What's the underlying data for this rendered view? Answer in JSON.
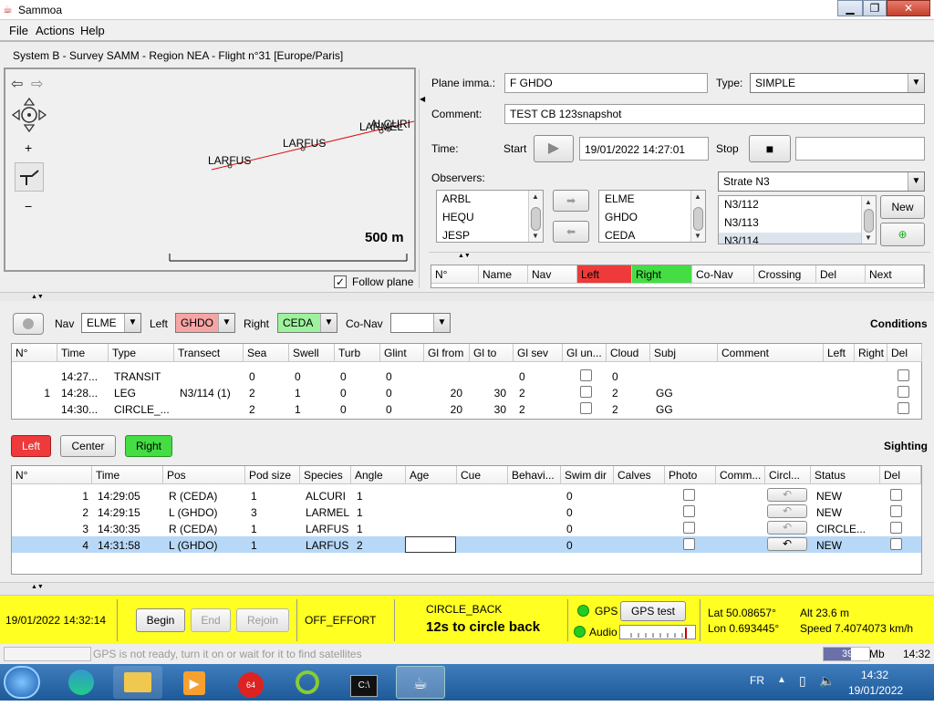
{
  "window": {
    "title": "Sammoa",
    "min": "▁",
    "max": "❐",
    "close": "✕"
  },
  "menu": {
    "file": "File",
    "actions": "Actions",
    "help": "Help"
  },
  "system_header": "System B - Survey SAMM - Region NEA - Flight n°31 [Europe/Paris]",
  "map": {
    "labels": [
      "LARFUS",
      "LARFUS",
      "LARMEL",
      "ALCURI"
    ],
    "scale": "500 m",
    "follow_plane": "Follow plane",
    "zoom_in": "+",
    "zoom_out": "−"
  },
  "flight": {
    "plane_label": "Plane imma.:",
    "plane_value": "F GHDO",
    "type_label": "Type:",
    "type_value": "SIMPLE",
    "comment_label": "Comment:",
    "comment_value": "TEST CB 123snapshot",
    "time_label": "Time:",
    "start_label": "Start",
    "start_value": "19/01/2022 14:27:01",
    "stop_label": "Stop",
    "stop_value": "",
    "observers_label": "Observers:",
    "observers_available": [
      "ARBL",
      "HEQU",
      "JESP"
    ],
    "observers_selected": [
      "ELME",
      "GHDO",
      "CEDA"
    ],
    "strate_value": "Strate N3",
    "transects": [
      "N3/112",
      "N3/113",
      "N3/114"
    ],
    "new_button": "New"
  },
  "leg_table": {
    "headers": [
      "N°",
      "Name",
      "Nav",
      "Left",
      "Right",
      "Co-Nav",
      "Crossing",
      "Del",
      "Next"
    ]
  },
  "crew": {
    "nav_label": "Nav",
    "nav_value": "ELME",
    "left_label": "Left",
    "left_value": "GHDO",
    "right_label": "Right",
    "right_value": "CEDA",
    "conav_label": "Co-Nav",
    "conav_value": "",
    "conditions_title": "Conditions"
  },
  "conditions": {
    "headers": [
      "N°",
      "Time",
      "Type",
      "Transect",
      "Sea",
      "Swell",
      "Turb",
      "Glint",
      "Gl from",
      "Gl to",
      "Gl sev",
      "Gl un...",
      "Cloud",
      "Subj",
      "Comment",
      "Left",
      "Right",
      "Del"
    ],
    "rows": [
      {
        "n": "",
        "time": "14:27...",
        "type": "TRANSIT",
        "transect": "",
        "sea": "0",
        "swell": "0",
        "turb": "0",
        "glint": "0",
        "glfrom": "",
        "glto": "",
        "glsev": "0",
        "cloud": "0",
        "subj": ""
      },
      {
        "n": "1",
        "time": "14:28...",
        "type": "LEG",
        "transect": "N3/114 (1)",
        "sea": "2",
        "swell": "1",
        "turb": "0",
        "glint": "0",
        "glfrom": "20",
        "glto": "30",
        "glsev": "2",
        "cloud": "2",
        "subj": "GG"
      },
      {
        "n": "",
        "time": "14:30...",
        "type": "CIRCLE_...",
        "transect": "",
        "sea": "2",
        "swell": "1",
        "turb": "0",
        "glint": "0",
        "glfrom": "20",
        "glto": "30",
        "glsev": "2",
        "cloud": "2",
        "subj": "GG"
      }
    ]
  },
  "sighting_buttons": {
    "left": "Left",
    "center": "Center",
    "right": "Right",
    "title": "Sighting"
  },
  "sightings": {
    "headers": [
      "N°",
      "Time",
      "Pos",
      "Pod size",
      "Species",
      "Angle",
      "Age",
      "Cue",
      "Behavi...",
      "Swim dir",
      "Calves",
      "Photo",
      "Comm...",
      "Circl...",
      "Status",
      "Del"
    ],
    "rows": [
      {
        "n": "1",
        "time": "14:29:05",
        "pos": "R (CEDA)",
        "pod": "1",
        "species": "ALCURI",
        "angle": "1",
        "swim": "0",
        "status": "NEW"
      },
      {
        "n": "2",
        "time": "14:29:15",
        "pos": "L (GHDO)",
        "pod": "3",
        "species": "LARMEL",
        "angle": "1",
        "swim": "0",
        "status": "NEW"
      },
      {
        "n": "3",
        "time": "14:30:35",
        "pos": "R (CEDA)",
        "pod": "1",
        "species": "LARFUS",
        "angle": "1",
        "swim": "0",
        "status": "CIRCLE..."
      },
      {
        "n": "4",
        "time": "14:31:58",
        "pos": "L (GHDO)",
        "pod": "1",
        "species": "LARFUS",
        "angle": "2",
        "swim": "0",
        "status": "NEW"
      }
    ]
  },
  "status": {
    "datetime": "19/01/2022 14:32:14",
    "begin": "Begin",
    "end": "End",
    "rejoin": "Rejoin",
    "effort": "OFF_EFFORT",
    "circle_title": "CIRCLE_BACK",
    "circle_msg": "12s to circle back",
    "gps": "GPS",
    "gps_test": "GPS test",
    "audio": "Audio",
    "lat": "Lat 50.08657°",
    "lon": "Lon 0.693445°",
    "alt": "Alt 23.6 m",
    "speed": "Speed 7.4074073 km/h"
  },
  "bottom": {
    "message": "GPS is not ready, turn it on or wait for it to find satellites",
    "memory": "39/67",
    "memory_unit": "Mb",
    "clock": "14:32"
  },
  "taskbar": {
    "lang": "FR",
    "time": "14:32",
    "date": "19/01/2022"
  },
  "colors": {
    "left": "#ee3a3a",
    "right": "#44dd44",
    "status_bg": "#ffff22",
    "selected_row": "#b8d8f8"
  }
}
